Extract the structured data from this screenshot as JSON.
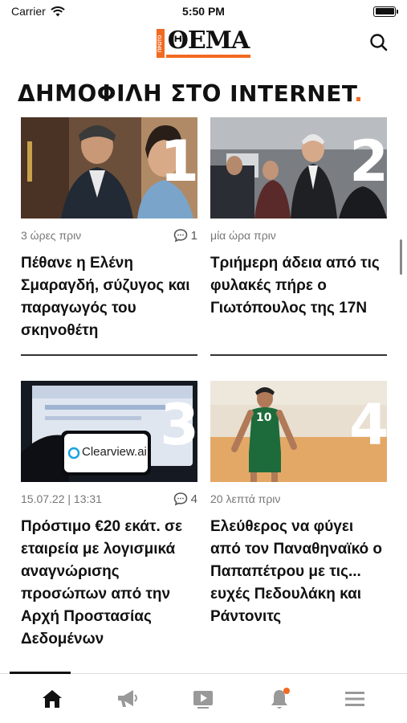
{
  "status": {
    "carrier": "Carrier",
    "time": "5:50 PM"
  },
  "header": {
    "logo_text": "ΘΕΜΑ",
    "logo_side": "ΠΡΩΤΟ"
  },
  "section": {
    "title": "ΔΗΜΟΦΙΛΗ ΣΤΟ INTERNET",
    "dot": "."
  },
  "articles": [
    {
      "rank": "1",
      "time": "3 ώρες πριν",
      "comments": "1",
      "headline": "Πέθανε η Ελένη Σμαραγδή, σύζυγος και παραγωγός του σκηνοθέτη"
    },
    {
      "rank": "2",
      "time": "μία ώρα πριν",
      "comments": "",
      "headline": "Τριήμερη άδεια από τις φυλακές πήρε ο Γιωτόπουλος της 17Ν"
    },
    {
      "rank": "3",
      "time": "15.07.22 | 13:31",
      "comments": "4",
      "headline": "Πρόστιμο €20 εκάτ. σε εταιρεία με λογισμικά αναγνώρισης προσώπων από την Αρχή Προστασίας Δεδομένων",
      "thumb_text": "Clearview.ai"
    },
    {
      "rank": "4",
      "time": "20 λεπτά πριν",
      "comments": "",
      "headline": "Ελεύθερος να φύγει από τον Παναθηναϊκό ο Παπαπέτρου με τις... ευχές Πεδουλάκη και Ράντονιτς",
      "jersey": "10"
    }
  ],
  "colors": {
    "accent": "#f26a21"
  },
  "tabs": [
    "home-icon",
    "megaphone-icon",
    "video-icon",
    "bell-icon",
    "menu-icon"
  ]
}
